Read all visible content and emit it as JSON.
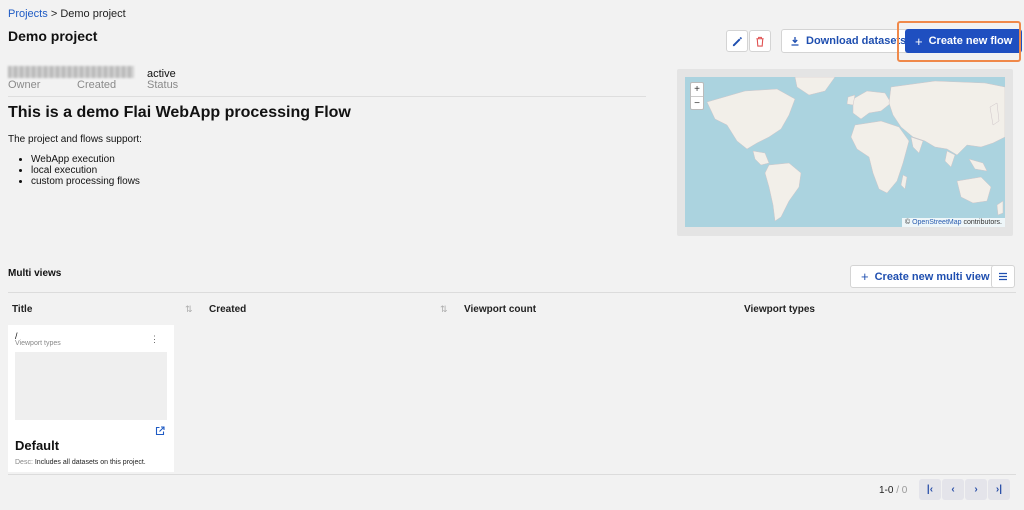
{
  "breadcrumb": {
    "link": "Projects",
    "separator": ">",
    "current": "Demo project"
  },
  "project": {
    "title": "Demo project",
    "status_value": "active",
    "owner_label": "Owner",
    "created_label": "Created",
    "status_label": "Status"
  },
  "toolbar": {
    "edit_icon": "pencil-icon",
    "delete_icon": "trash-icon",
    "download_label": "Download datasets",
    "create_flow_label": "Create new flow",
    "accent": "#1f4fc0",
    "highlight": "#f0894a"
  },
  "description": {
    "heading": "This is a demo Flai WebApp processing Flow",
    "intro": "The project and flows support:",
    "items": [
      "WebApp execution",
      "local execution",
      "custom processing flows"
    ]
  },
  "map": {
    "zoom_in": "+",
    "zoom_out": "−",
    "attribution_prefix": "©",
    "attribution_link": "OpenStreetMap",
    "attribution_suffix": "contributors."
  },
  "multiviews": {
    "section_title": "Multi views",
    "create_label": "Create new multi view",
    "columns": [
      "Title",
      "Created",
      "Viewport count",
      "Viewport types"
    ],
    "card": {
      "path": "/",
      "subtitle": "Viewport types",
      "name": "Default",
      "desc_key": "Desc:",
      "desc_value": "Includes all datasets on this project."
    }
  },
  "pagination": {
    "range": "1-0",
    "separator": "/",
    "total": "0"
  }
}
